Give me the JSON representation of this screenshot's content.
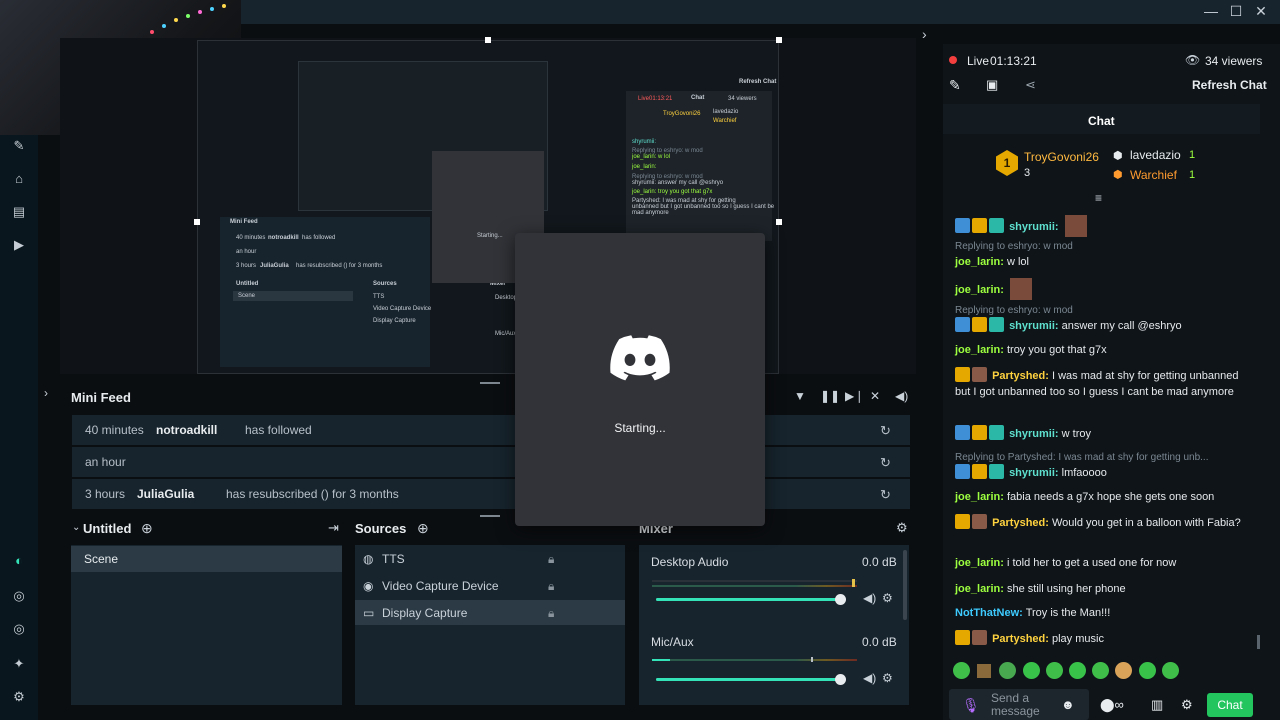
{
  "window": {
    "minimize": "—",
    "maximize": "☐",
    "close": "✕"
  },
  "live": {
    "status": "Live",
    "time": "01:13:21",
    "viewers": "34 viewers",
    "refresh_chat": "Refresh Chat"
  },
  "chat": {
    "title": "Chat",
    "leaderboard": {
      "first_name": "TroyGovoni26",
      "first_count": "3",
      "second_name": "lavedazio",
      "second_count": "1",
      "third_name": "Warchief",
      "third_count": "1"
    },
    "messages": [
      {
        "reply": "",
        "user": "shyrumii:",
        "user_color": "teal",
        "text": "",
        "emote": true
      },
      {
        "reply": "Replying to eshryo: w mod",
        "user": "joe_larin:",
        "user_color": "green",
        "text": "w lol",
        "emote": false
      },
      {
        "reply": "",
        "user": "joe_larin:",
        "user_color": "green",
        "text": "",
        "emote": true
      },
      {
        "reply": "Replying to eshryo: w mod",
        "user": "shyrumii:",
        "user_color": "teal",
        "text": "answer my call @eshryo",
        "emote": false
      },
      {
        "reply": "",
        "user": "joe_larin:",
        "user_color": "green",
        "text": "troy you got that g7x",
        "emote": false
      },
      {
        "reply": "",
        "user": "Partyshed:",
        "user_color": "gold",
        "text": "I was mad at shy for getting unbanned but I got unbanned too so I guess I cant be mad anymore",
        "emote": false
      },
      {
        "reply": "",
        "user": "shyrumii:",
        "user_color": "teal",
        "text": "w troy",
        "emote": false
      },
      {
        "reply": "Replying to Partyshed: I was mad at shy for getting unb...",
        "user": "shyrumii:",
        "user_color": "teal",
        "text": "lmfaoooo",
        "emote": false
      },
      {
        "reply": "",
        "user": "joe_larin:",
        "user_color": "green",
        "text": "fabia needs a g7x hope she gets one soon",
        "emote": false
      },
      {
        "reply": "",
        "user": "Partyshed:",
        "user_color": "gold",
        "text": "Would you get in a balloon with Fabia?",
        "emote": false
      },
      {
        "reply": "",
        "user": "joe_larin:",
        "user_color": "green",
        "text": "i told her to get a used one for now",
        "emote": false
      },
      {
        "reply": "",
        "user": "joe_larin:",
        "user_color": "green",
        "text": "she still using her phone",
        "emote": false
      },
      {
        "reply": "",
        "user": "NotThatNew:",
        "user_color": "cyan",
        "text": "Troy is the Man!!!",
        "emote": false
      },
      {
        "reply": "",
        "user": "Partyshed:",
        "user_color": "gold",
        "text": "play music",
        "emote": false
      }
    ],
    "input_placeholder": "Send a message",
    "send_button": "Chat"
  },
  "minifeed": {
    "title": "Mini Feed",
    "rows": [
      {
        "time": "40 minutes",
        "user": "notroadkill",
        "action": "has followed"
      },
      {
        "time": "an hour",
        "user": "",
        "action": ""
      },
      {
        "time": "3 hours",
        "user": "JuliaGulia",
        "action": "has resubscribed () for 3 months"
      }
    ]
  },
  "scenes": {
    "title": "Untitled",
    "items": [
      "Scene"
    ]
  },
  "sources": {
    "title": "Sources",
    "items": [
      "TTS",
      "Video Capture Device",
      "Display Capture"
    ]
  },
  "mixer": {
    "title": "Mixer",
    "channels": [
      {
        "name": "Desktop Audio",
        "level": "0.0 dB"
      },
      {
        "name": "Mic/Aux",
        "level": "0.0 dB"
      }
    ]
  },
  "discord": {
    "status": "Starting..."
  },
  "preview": {
    "live_time": "Live01:13:21",
    "viewers": "34 viewers",
    "refresh": "Refresh Chat",
    "chat": "Chat",
    "top1": "TroyGovoni26",
    "top2": "lavedazio",
    "top3": "Warchief",
    "msgs": [
      "shyrumii:",
      "Replying to eshryo: w mod",
      "joe_larin: w lol",
      "joe_larin:",
      "Replying to eshryo: w mod",
      "shyrumii: answer my call @eshryo",
      "joe_larin: troy you got that g7x",
      "Partyshed: I was mad at shy for getting",
      "unbanned but I got unbanned too so I guess I cant be",
      "mad anymore"
    ],
    "minifeed": "Mini Feed",
    "feed1_time": "40 minutes",
    "feed1_user": "notroadkill",
    "feed1_action": "has followed",
    "feed2": "an hour",
    "feed3_time": "3 hours",
    "feed3_user": "JuliaGulia",
    "feed3_action": "has resubscribed () for 3 months",
    "untitled": "Untitled",
    "scene": "Scene",
    "sources": "Sources",
    "src1": "TTS",
    "src2": "Video Capture Device",
    "src3": "Display Capture",
    "mixer": "Mixer",
    "desktop": "Desktop",
    "micaux": "Mic/Aux",
    "starting": "Starting..."
  },
  "colors": {
    "accent": "#35e3b8",
    "chat_button": "#22c55e",
    "panel": "#17242d",
    "live_dot": "#f43f3f"
  }
}
